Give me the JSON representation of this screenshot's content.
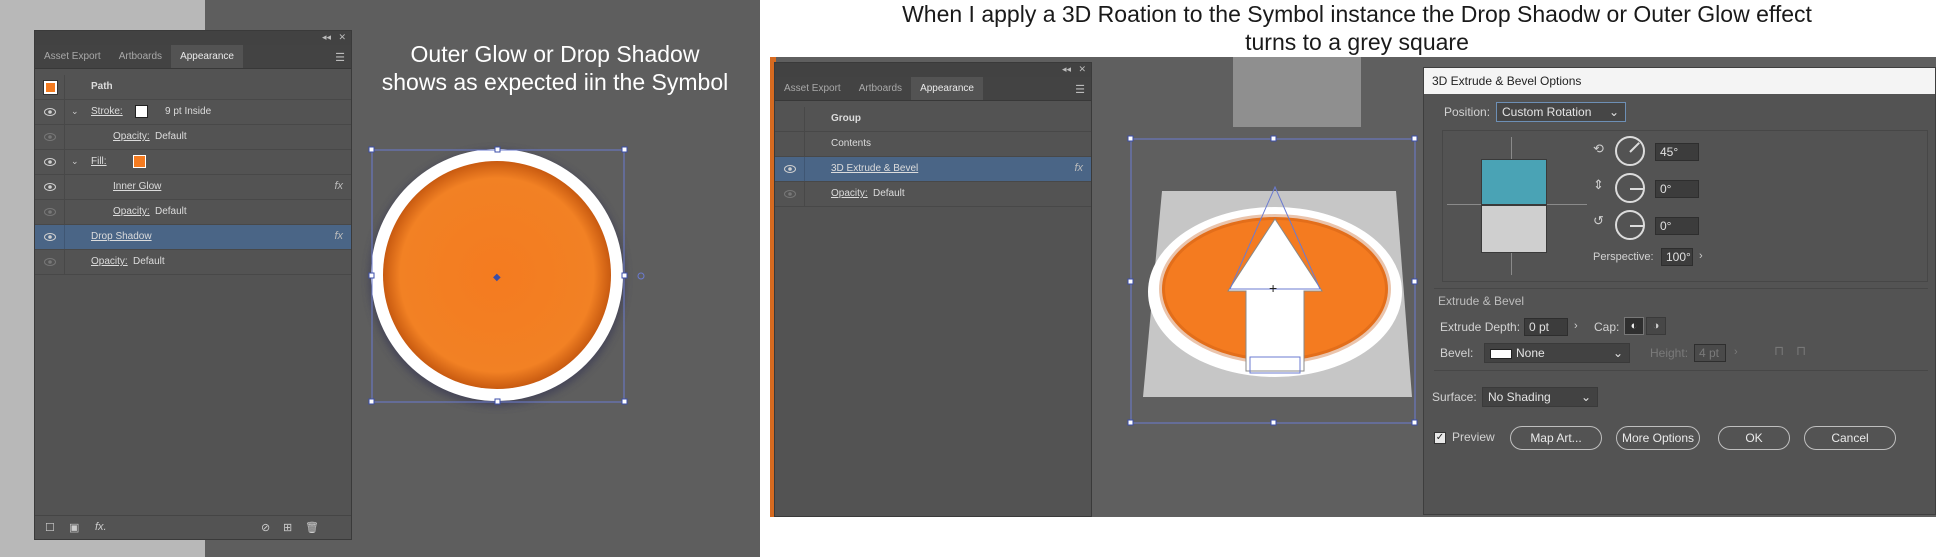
{
  "left": {
    "caption": "Outer Glow or Drop Shadow\nshows as expected iin the Symbol",
    "tabs": [
      "Asset Export",
      "Artboards",
      "Appearance"
    ],
    "rows": {
      "path": "Path",
      "stroke_label": "Stroke:",
      "stroke_value": "9 pt  Inside",
      "opacity1_label": "Opacity:",
      "opacity1_value": "Default",
      "fill_label": "Fill:",
      "inner_glow": "Inner Glow",
      "opacity2_label": "Opacity:",
      "opacity2_value": "Default",
      "drop_shadow": "Drop Shadow",
      "opacity3_label": "Opacity:",
      "opacity3_value": "Default"
    },
    "fx": "fx",
    "bottom_fx": "fx."
  },
  "right": {
    "title": "When I apply a 3D Roation to the Symbol instance the Drop Shaodw or Outer Glow effect\nturns to a grey square",
    "tabs": [
      "Asset Export",
      "Artboards",
      "Appearance"
    ],
    "rows": {
      "group": "Group",
      "contents": "Contents",
      "extrude": "3D Extrude & Bevel",
      "opacity_label": "Opacity:",
      "opacity_value": "Default"
    },
    "fx": "fx",
    "dialog": {
      "title": "3D Extrude & Bevel Options",
      "position_label": "Position:",
      "position_value": "Custom Rotation",
      "rot_x": "45°",
      "rot_y": "0°",
      "rot_z": "0°",
      "perspective_label": "Perspective:",
      "perspective_value": "100°",
      "section": "Extrude & Bevel",
      "depth_label": "Extrude Depth:",
      "depth_value": "0 pt",
      "cap_label": "Cap:",
      "bevel_label": "Bevel:",
      "bevel_value": "None",
      "height_label": "Height:",
      "height_value": "4 pt",
      "surface_label": "Surface:",
      "surface_value": "No Shading",
      "preview_label": "Preview",
      "map_art": "Map Art...",
      "more_options": "More Options",
      "ok": "OK",
      "cancel": "Cancel"
    }
  },
  "colors": {
    "orange": "#f47b20",
    "selection": "#4a6586",
    "cube_top": "#4aa3b5",
    "cube_bottom": "#cfcfcf"
  }
}
